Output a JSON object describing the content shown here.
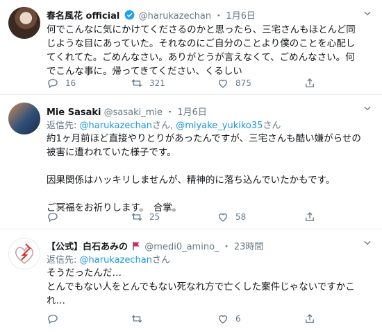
{
  "tweets": [
    {
      "display_name": "春名風花 official",
      "handle": "@harukazechan",
      "time": "1月6日",
      "text_lines": [
        "何でこんなに気にかけてくださるのかと思ったら、三宅さんもほとんど同",
        "じような目にあっていた。それなのにご自分のことより僕のことを心配し",
        "てくれてた。ごめんなさい。ありがとうが言えなくて、ごめんなさい。何",
        "でこんな事に。帰ってきてください、くるしい"
      ],
      "replies": "16",
      "retweets": "321",
      "likes": "875"
    },
    {
      "display_name": "Mie Sasaki",
      "handle": "@sasaki_mie",
      "time": "1月6日",
      "reply_prefix": "返信先: ",
      "reply_user1": "@harukazechan",
      "reply_san1": "さん, ",
      "reply_user2": "@miyake_yukiko35",
      "reply_san2": "さん",
      "paragraphs": [
        [
          "約1ヶ月前ほど直接やりとりがあったんですが、三宅さんも酷い嫌がらせの",
          "被害に遭われていた様子です。"
        ],
        [
          "因果関係はハッキリしませんが、精神的に落ち込んでいたかもです。"
        ],
        [
          "ご冥福をお祈りします。　合掌。"
        ]
      ],
      "replies": "",
      "retweets": "25",
      "likes": "58"
    },
    {
      "display_name": "【公式】白石あみの",
      "handle": "@medi0_amino_",
      "time": "23時間",
      "reply_prefix": "返信先: ",
      "reply_user1": "@harukazechan",
      "reply_san1": "さん",
      "text_lines": [
        "そうだったんだ…",
        "とんでもない人をとんでもない死なれ方で亡くした案件じゃないですかこ",
        "れ…"
      ],
      "replies": "",
      "retweets": "",
      "likes": "6"
    }
  ],
  "separator": "・",
  "colors": {
    "link": "#1b95e0",
    "muted": "#657786",
    "text": "#14171a",
    "verified": "#1da1f2",
    "flag": "#e0245e"
  }
}
